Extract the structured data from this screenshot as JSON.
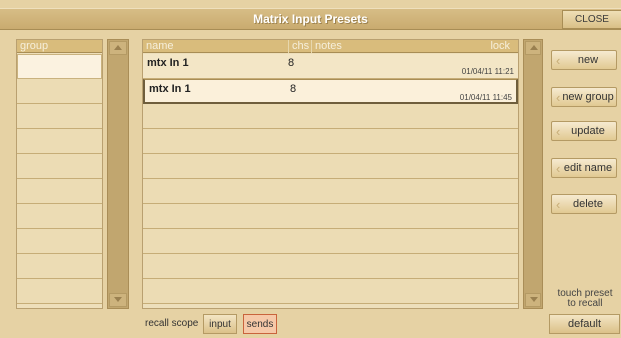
{
  "window": {
    "title": "Matrix Input Presets",
    "close_label": "CLOSE"
  },
  "group_panel": {
    "header": "group",
    "rows": 11,
    "selected_row": 0
  },
  "preset_list": {
    "headers": {
      "name": "name",
      "chs": "chs",
      "notes": "notes",
      "lock": "lock"
    },
    "rows": [
      {
        "name": "mtx In 1",
        "chs": "8",
        "date": "01/04/11 11:21"
      },
      {
        "name": "mtx In 1",
        "chs": "8",
        "date": "01/04/11 11:45"
      }
    ],
    "empty_rows": 8
  },
  "side_buttons": {
    "new": "new",
    "new_group": "new group",
    "update": "update",
    "edit_name": "edit name",
    "delete": "delete"
  },
  "touch_hint": "touch preset to recall",
  "default_label": "default",
  "recall_scope": {
    "label": "recall scope",
    "input": "input",
    "sends": "sends",
    "active": "sends"
  },
  "colors": {
    "background": "#e6d2a4",
    "header": "#d9bc7c",
    "active_scope": "#f6c9a8"
  }
}
